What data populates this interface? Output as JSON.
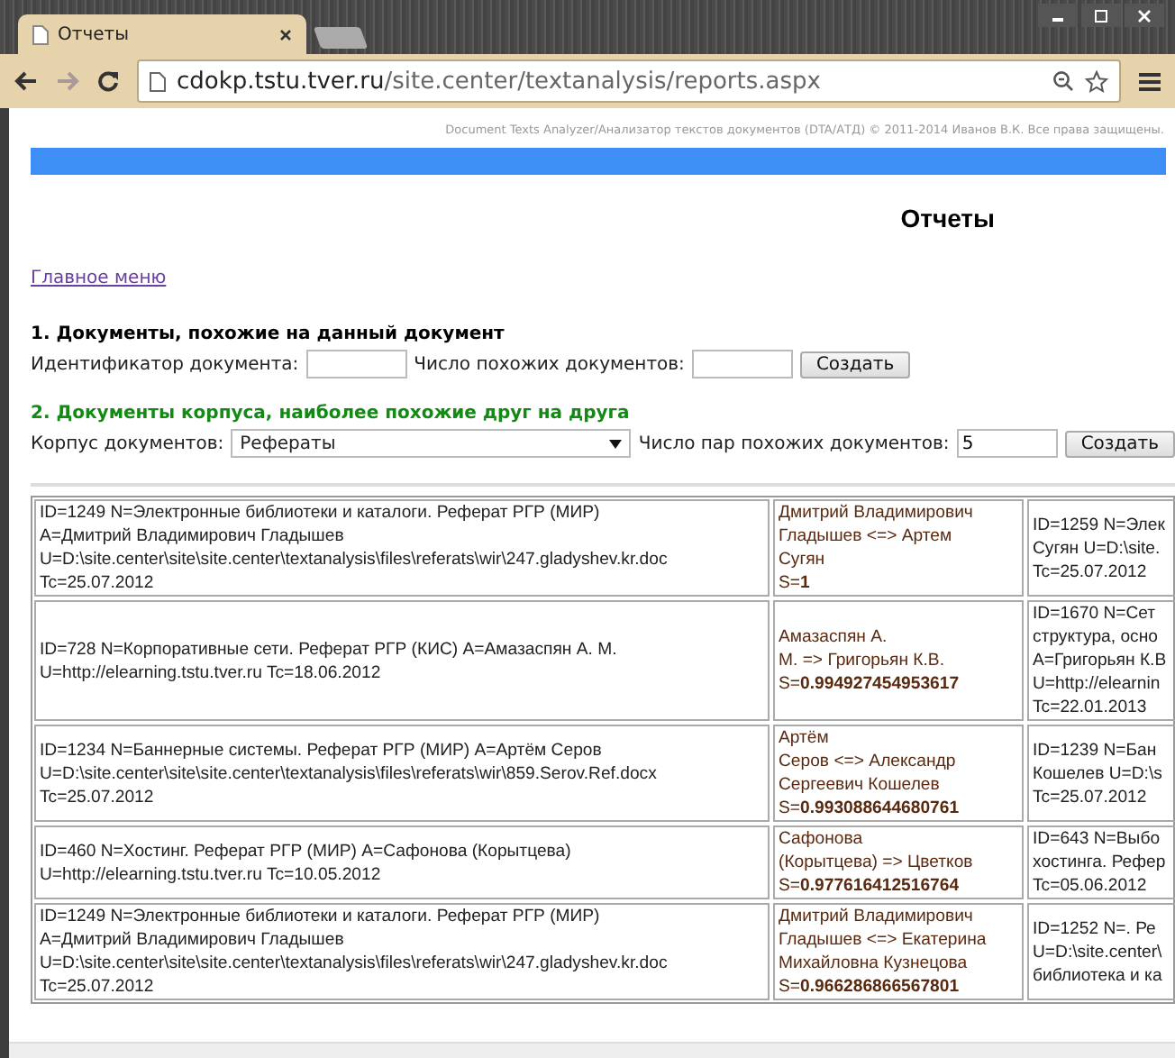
{
  "browser": {
    "tab_title": "Отчеты",
    "url_host": "cdokp.tstu.tver.ru",
    "url_path": "/site.center/textanalysis/reports.aspx"
  },
  "page": {
    "copyright": "Document Texts Analyzer/Анализатор текстов документов (DTA/АТД) © 2011-2014 Иванов В.К. Все права защищены.",
    "title": "Отчеты",
    "main_menu_link": "Главное меню",
    "section1": {
      "heading": "1. Документы, похожие на данный документ",
      "id_label": "Идентификатор документа:",
      "count_label": "Число похожих документов:",
      "button": "Создать"
    },
    "section2": {
      "heading": "2. Документы корпуса, наиболее похожие друг на друга",
      "corpus_label": "Корпус документов:",
      "corpus_value": "Рефераты",
      "pairs_label": "Число пар похожих документов:",
      "pairs_value": "5",
      "button": "Создать"
    }
  },
  "table": {
    "rows": [
      {
        "document": [
          "ID=1249 N=Электронные библиотеки и каталоги. Реферат РГР (МИР)",
          "A=Дмитрий Владимирович Гладышев",
          "U=D:\\site.center\\site\\site.center\\textanalysis\\files\\referats\\wir\\247.gladyshev.kr.doc",
          "Tc=25.07.2012"
        ],
        "pair": [
          "Дмитрий Владимирович",
          "Гладышев <=> Артем",
          "Сугян",
          "S=**1**"
        ],
        "column_3": [
          "ID=1259 N=Элек",
          "Сугян U=D:\\site.",
          "Tc=25.07.2012"
        ]
      },
      {
        "document": [
          "ID=728 N=Корпоративные сети. Реферат РГР (КИС) A=Амазаспян А. М.",
          "U=http://elearning.tstu.tver.ru Tc=18.06.2012"
        ],
        "pair": [
          "Амазаспян А.",
          "М. => Григорьян К.В.",
          "S=**0.994927454953617**"
        ],
        "column_3": [
          "ID=1670 N=Сет",
          "структура, осно",
          "A=Григорьян К.В",
          "U=http://elearnin",
          "Tc=22.01.2013"
        ]
      },
      {
        "document": [
          "ID=1234 N=Баннерные системы. Реферат РГР (МИР) A=Артём Серов",
          "U=D:\\site.center\\site\\site.center\\textanalysis\\files\\referats\\wir\\859.Serov.Ref.docx",
          "Tc=25.07.2012"
        ],
        "pair": [
          "Артём",
          "Серов <=> Александр",
          "Сергеевич Кошелев",
          "S=**0.993088644680761**"
        ],
        "column_3": [
          "ID=1239 N=Бан",
          "Кошелев U=D:\\s",
          "Tc=25.07.2012"
        ]
      },
      {
        "document": [
          "ID=460 N=Хостинг. Реферат РГР (МИР) A=Сафонова (Корытцева)",
          "U=http://elearning.tstu.tver.ru Tc=10.05.2012"
        ],
        "pair": [
          "Сафонова",
          "(Корытцева) => Цветков",
          "S=**0.977616412516764**"
        ],
        "column_3": [
          "ID=643 N=Выбо",
          "хостинга. Рефер",
          "Tc=05.06.2012"
        ]
      },
      {
        "document": [
          "ID=1249 N=Электронные библиотеки и каталоги. Реферат РГР (МИР)",
          "A=Дмитрий Владимирович Гладышев",
          "U=D:\\site.center\\site\\site.center\\textanalysis\\files\\referats\\wir\\247.gladyshev.kr.doc",
          "Tc=25.07.2012"
        ],
        "pair": [
          "Дмитрий Владимирович",
          "Гладышев <=> Екатерина",
          "Михайловна Кузнецова",
          "S=**0.966286866567801**"
        ],
        "column_3": [
          "ID=1252 N=. Ре",
          "U=D:\\site.center\\",
          "библиотека и ка"
        ]
      }
    ]
  }
}
